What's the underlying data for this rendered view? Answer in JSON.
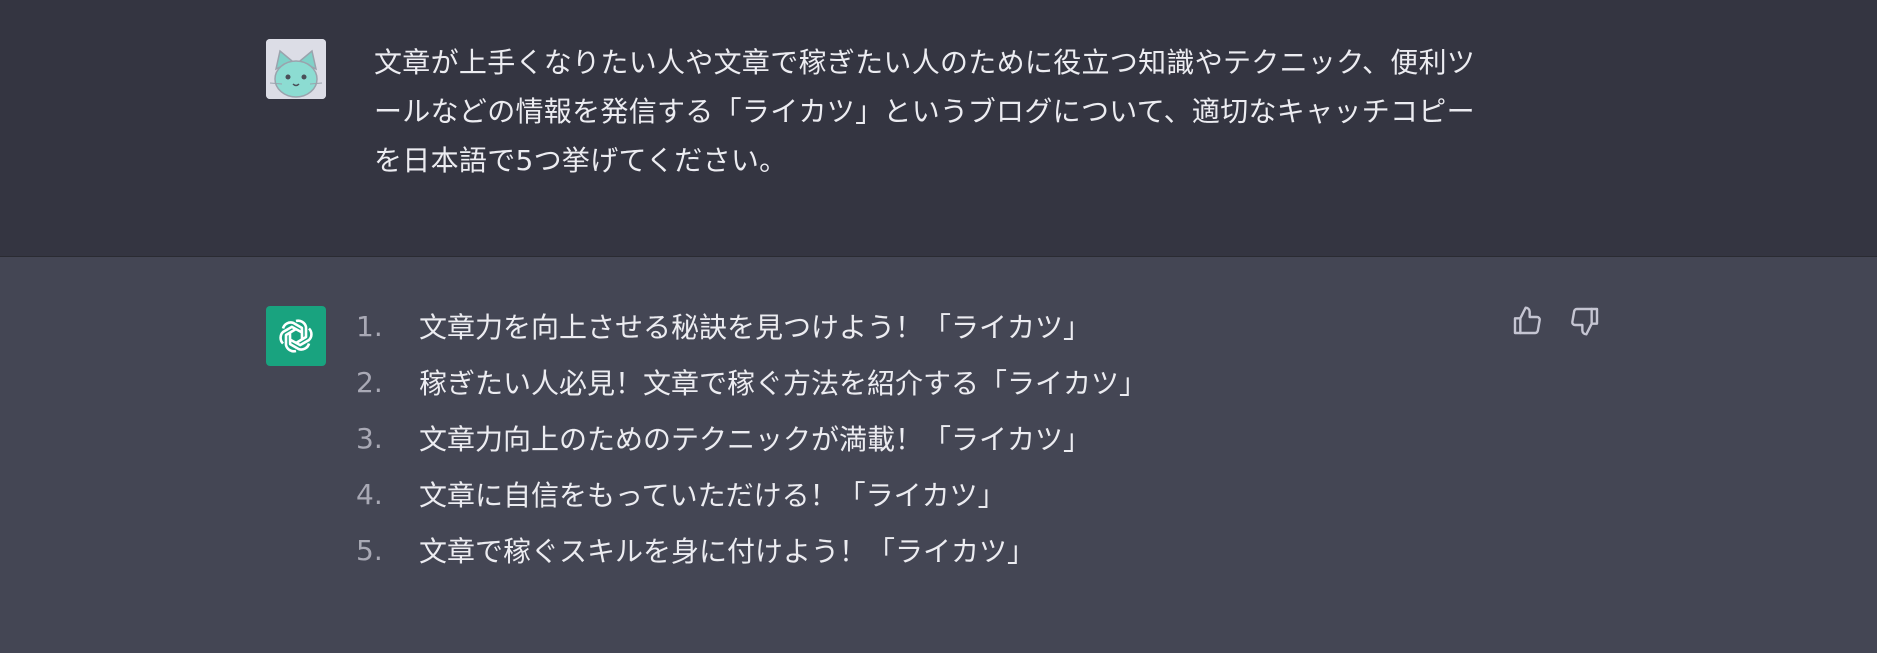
{
  "user_message": {
    "text": "文章が上手くなりたい人や文章で稼ぎたい人のために役立つ知識やテクニック、便利ツールなどの情報を発信する「ライカツ」というブログについて、適切なキャッチコピーを日本語で5つ挙げてください。"
  },
  "assistant_message": {
    "items": [
      {
        "num": "1.",
        "text": "文章力を向上させる秘訣を見つけよう！「ライカツ」"
      },
      {
        "num": "2.",
        "text": "稼ぎたい人必見！文章で稼ぐ方法を紹介する「ライカツ」"
      },
      {
        "num": "3.",
        "text": "文章力向上のためのテクニックが満載！「ライカツ」"
      },
      {
        "num": "4.",
        "text": "文章に自信をもっていただける！「ライカツ」"
      },
      {
        "num": "5.",
        "text": "文章で稼ぐスキルを身に付けよう！「ライカツ」"
      }
    ]
  },
  "icons": {
    "user_avatar": "cat-avatar-icon",
    "assistant_avatar": "openai-logo-icon",
    "thumbs_up": "thumbs-up-icon",
    "thumbs_down": "thumbs-down-icon"
  },
  "colors": {
    "user_bg": "#343541",
    "assistant_bg": "#444654",
    "text": "#ececf1",
    "list_number": "#a9a9b5",
    "bot_avatar_bg": "#19a37f"
  }
}
